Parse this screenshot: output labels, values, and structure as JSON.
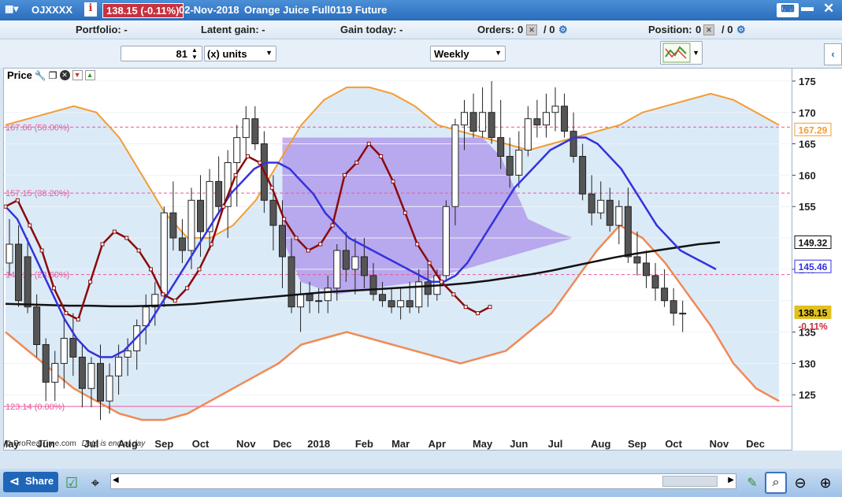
{
  "header": {
    "ticker": "OJXXXX",
    "price_badge": "138.15 (-0.11%)",
    "date_label": "02-Nov-2018",
    "instrument": "Orange Juice Full0119 Future"
  },
  "status": {
    "portfolio": "Portfolio: -",
    "latent_gain": "Latent gain: -",
    "gain_today": "Gain today: -",
    "orders_label": "Orders:",
    "orders_count": "0",
    "orders_slash": "/ 0",
    "position_label": "Position:",
    "position_count": "0",
    "position_slash": "/ 0"
  },
  "toolbar": {
    "quantity": "81",
    "units_label": "(x) units",
    "period": "Weekly"
  },
  "panel": {
    "label": "Price"
  },
  "footer": {
    "copyright": "© ProRealTime.com",
    "note": "Data is end of day",
    "share": "Share"
  },
  "colors": {
    "up": "#ffffff",
    "down": "#555555",
    "ma_fast": "#3333dd",
    "ma_slow": "#111111",
    "osc": "#8b0a0a",
    "bollinger": "#f39c32",
    "ichimoku_cloud": "#9b71e6",
    "fib": "#e85a9e"
  },
  "chart_data": {
    "type": "candlestick",
    "ylim": [
      119,
      177
    ],
    "y_ticks": [
      125,
      130,
      135,
      140,
      145,
      150,
      155,
      160,
      165,
      170,
      175
    ],
    "x_labels": [
      {
        "label": "May",
        "i": 0
      },
      {
        "label": "Jun",
        "i": 4
      },
      {
        "label": "Jul",
        "i": 9
      },
      {
        "label": "Aug",
        "i": 13
      },
      {
        "label": "Sep",
        "i": 17
      },
      {
        "label": "Oct",
        "i": 21
      },
      {
        "label": "Nov",
        "i": 26
      },
      {
        "label": "Dec",
        "i": 30
      },
      {
        "label": "2018",
        "i": 34
      },
      {
        "label": "Feb",
        "i": 39
      },
      {
        "label": "Mar",
        "i": 43
      },
      {
        "label": "Apr",
        "i": 47
      },
      {
        "label": "May",
        "i": 52
      },
      {
        "label": "Jun",
        "i": 56
      },
      {
        "label": "Jul",
        "i": 60
      },
      {
        "label": "Aug",
        "i": 65
      },
      {
        "label": "Sep",
        "i": 69
      },
      {
        "label": "Oct",
        "i": 73
      },
      {
        "label": "Nov",
        "i": 78
      },
      {
        "label": "Dec",
        "i": 82
      }
    ],
    "candles": [
      [
        146,
        153,
        144,
        149
      ],
      [
        149,
        152,
        139,
        140
      ],
      [
        147,
        150,
        138,
        139
      ],
      [
        139,
        141,
        131,
        133
      ],
      [
        133,
        134,
        124,
        127
      ],
      [
        127,
        132,
        124,
        130
      ],
      [
        130,
        137,
        126,
        134
      ],
      [
        134,
        138,
        128,
        131
      ],
      [
        131,
        133,
        123,
        126
      ],
      [
        126,
        131,
        123,
        130
      ],
      [
        130,
        133,
        121,
        124
      ],
      [
        124,
        130,
        122,
        128
      ],
      [
        128,
        133,
        125,
        131
      ],
      [
        131,
        134,
        128,
        132
      ],
      [
        132,
        137,
        129,
        136
      ],
      [
        136,
        141,
        133,
        139
      ],
      [
        139,
        143,
        136,
        141
      ],
      [
        141,
        155,
        139,
        154
      ],
      [
        154,
        159,
        148,
        150
      ],
      [
        150,
        153,
        146,
        148
      ],
      [
        148,
        158,
        145,
        156
      ],
      [
        156,
        160,
        147,
        151
      ],
      [
        151,
        161,
        148,
        159
      ],
      [
        159,
        163,
        154,
        155
      ],
      [
        155,
        164,
        150,
        162
      ],
      [
        162,
        168,
        155,
        166
      ],
      [
        166,
        171,
        163,
        169
      ],
      [
        169,
        171,
        164,
        165
      ],
      [
        165,
        167,
        154,
        156
      ],
      [
        156,
        160,
        148,
        152
      ],
      [
        152,
        156,
        142,
        147
      ],
      [
        147,
        150,
        138,
        139
      ],
      [
        139,
        143,
        135,
        141
      ],
      [
        141,
        143,
        138,
        140
      ],
      [
        140,
        142,
        138,
        140
      ],
      [
        140,
        144,
        138,
        142
      ],
      [
        142,
        149,
        140,
        148
      ],
      [
        148,
        151,
        143,
        145
      ],
      [
        145,
        150,
        141,
        147
      ],
      [
        147,
        150,
        142,
        144
      ],
      [
        144,
        146,
        140,
        141
      ],
      [
        141,
        143,
        139,
        140
      ],
      [
        140,
        142,
        138,
        139
      ],
      [
        139,
        142,
        137,
        140
      ],
      [
        140,
        143,
        138,
        139
      ],
      [
        139,
        145,
        138,
        143
      ],
      [
        143,
        146,
        139,
        141
      ],
      [
        141,
        145,
        140,
        144
      ],
      [
        144,
        156,
        143,
        155
      ],
      [
        155,
        169,
        152,
        168
      ],
      [
        168,
        172,
        164,
        170
      ],
      [
        170,
        173,
        166,
        167
      ],
      [
        167,
        174,
        166,
        170
      ],
      [
        170,
        175,
        165,
        166
      ],
      [
        166,
        172,
        161,
        163
      ],
      [
        163,
        166,
        158,
        160
      ],
      [
        160,
        167,
        158,
        164
      ],
      [
        164,
        171,
        163,
        169
      ],
      [
        169,
        172,
        166,
        168
      ],
      [
        168,
        173,
        166,
        170
      ],
      [
        170,
        174,
        167,
        171
      ],
      [
        171,
        173,
        166,
        167
      ],
      [
        167,
        170,
        162,
        163
      ],
      [
        163,
        165,
        156,
        157
      ],
      [
        157,
        160,
        152,
        154
      ],
      [
        154,
        159,
        153,
        156
      ],
      [
        156,
        158,
        151,
        152
      ],
      [
        152,
        156,
        149,
        155
      ],
      [
        155,
        158,
        146,
        147
      ],
      [
        147,
        151,
        144,
        146
      ],
      [
        146,
        148,
        142,
        144
      ],
      [
        144,
        146,
        140,
        142
      ],
      [
        142,
        145,
        139,
        140
      ],
      [
        140,
        142,
        136,
        138
      ],
      [
        138,
        140,
        135,
        138
      ]
    ],
    "ma_fast": [
      155,
      153,
      149,
      145,
      141,
      137,
      134,
      132,
      131,
      131,
      132,
      134,
      136,
      139,
      142,
      145,
      148,
      151,
      154,
      157,
      159,
      161,
      162,
      162,
      161,
      159,
      157,
      154,
      152,
      150,
      149,
      148,
      147,
      146,
      145,
      144,
      143,
      143,
      144,
      146,
      149,
      152,
      155,
      158,
      160,
      162,
      164,
      165,
      166,
      166,
      165,
      163,
      161,
      158,
      155,
      152,
      150,
      148,
      147,
      146,
      145
    ],
    "ma_slow": [
      139.5,
      139.4,
      139.3,
      139.2,
      139.2,
      139.1,
      139.1,
      139.2,
      139.3,
      139.5,
      139.8,
      140.1,
      140.4,
      140.7,
      141.0,
      141.3,
      141.5,
      141.7,
      141.9,
      142.1,
      142.3,
      142.5,
      142.8,
      143.2,
      143.7,
      144.2,
      144.8,
      145.5,
      146.2,
      146.9,
      147.5,
      148.0,
      148.5,
      149.0,
      149.32
    ],
    "oscillator": [
      155,
      156,
      152,
      148,
      142,
      138,
      137,
      143,
      149,
      151,
      150,
      148,
      145,
      141,
      140,
      142,
      145,
      149,
      155,
      160,
      163,
      162,
      158,
      153,
      150,
      148,
      149,
      152,
      160,
      162,
      165,
      163,
      159,
      154,
      149,
      146,
      143,
      141,
      139,
      138,
      139
    ],
    "bollinger_upper": [
      168,
      169,
      170,
      171,
      170,
      166,
      160,
      154,
      150,
      150,
      152,
      156,
      162,
      168,
      172,
      174,
      174,
      173,
      171,
      168,
      167,
      166,
      165,
      164,
      165,
      166,
      167,
      168,
      170,
      171,
      172,
      173,
      172,
      170,
      168
    ],
    "bollinger_lower": [
      135,
      132,
      129,
      126,
      124,
      122,
      121,
      121,
      122,
      124,
      126,
      128,
      130,
      133,
      134,
      135,
      134,
      133,
      132,
      131,
      130,
      131,
      132,
      135,
      138,
      143,
      148,
      152,
      150,
      146,
      141,
      136,
      130,
      126,
      124
    ],
    "fib_levels": [
      {
        "value": 167.66,
        "label": "167.66 (50.00%)"
      },
      {
        "value": 157.15,
        "label": "157.15 (38.20%)"
      },
      {
        "value": 144.16,
        "label": "144.16 (23.60%)"
      },
      {
        "value": 123.14,
        "label": "123.14 (0.00%)"
      }
    ],
    "axis_badges": [
      {
        "value": 167.29,
        "label": "167.29",
        "color": "#f39c32"
      },
      {
        "value": 149.32,
        "label": "149.32",
        "color": "#111111"
      },
      {
        "value": 145.46,
        "label": "145.46",
        "color": "#3333dd"
      },
      {
        "value": 138.15,
        "label": "138.15",
        "color": "#e0c020"
      }
    ],
    "change_label": "-0.11%"
  }
}
